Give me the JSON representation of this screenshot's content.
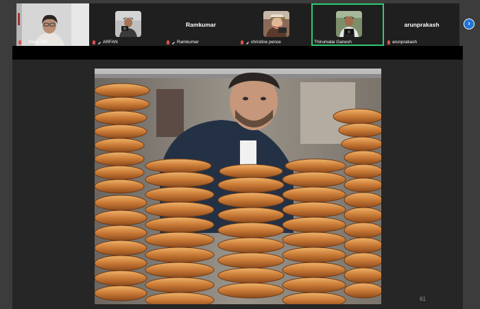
{
  "participants": [
    {
      "name": "Reha Bilir",
      "video": true
    },
    {
      "name": "ARFAN",
      "video": false,
      "avatar": "photographer"
    },
    {
      "name": "Ramkumar",
      "video": false
    },
    {
      "name": "christine pence",
      "video": false,
      "avatar": "woman-camera"
    },
    {
      "name": "Thirumalai Ganesh",
      "video": false,
      "avatar": "man-camera",
      "active": true
    },
    {
      "name": "arunprakash",
      "video": false
    }
  ],
  "big_names": {
    "ramkumar": "Ramkumar",
    "arunprakash": "arunprakash"
  },
  "next_icon": "chevron-right-icon",
  "slide": {
    "page_number": "61",
    "image": "simit-seller-photo"
  },
  "colors": {
    "active_border": "#2ecc71",
    "next_button": "#1e74d8",
    "mic_muted": "#d9534f"
  }
}
